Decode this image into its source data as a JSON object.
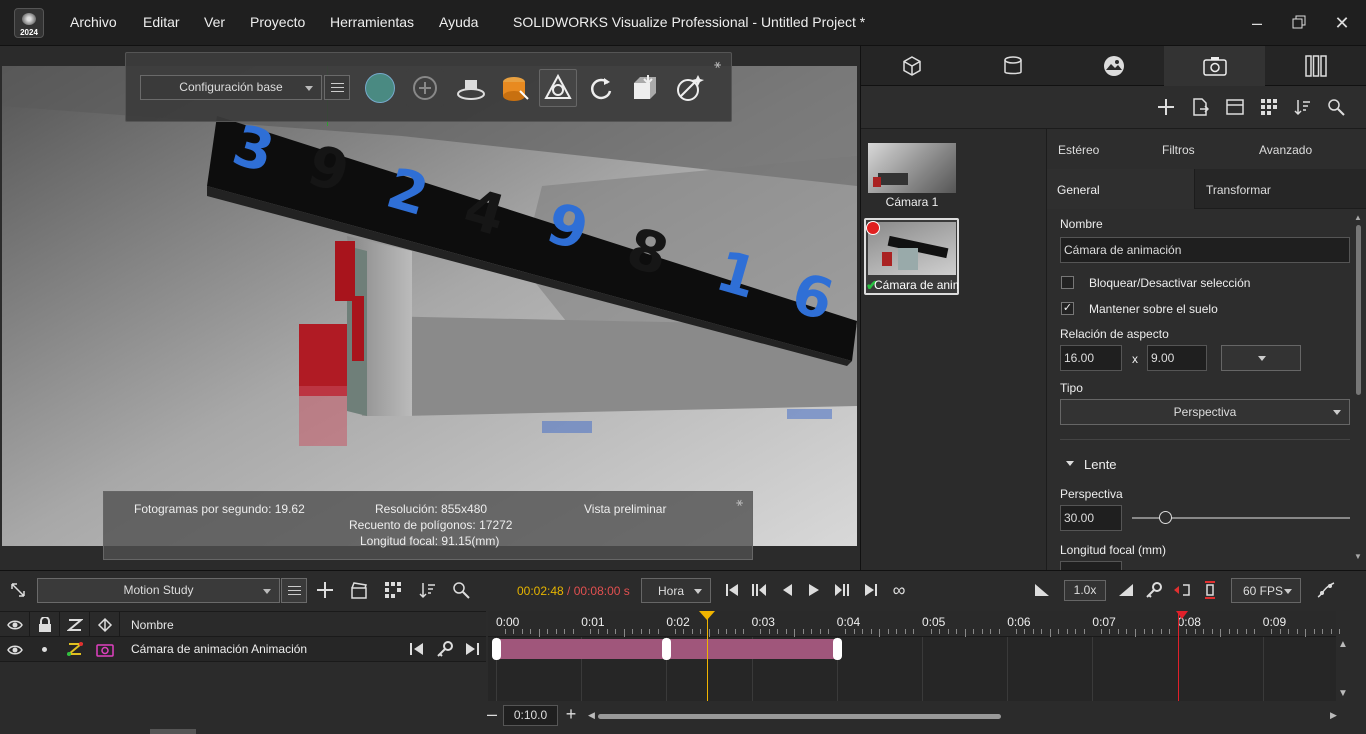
{
  "app": {
    "logo_year": "2024",
    "title": "SOLIDWORKS Visualize Professional - Untitled Project *",
    "menu": [
      "Archivo",
      "Editar",
      "Ver",
      "Proyecto",
      "Herramientas",
      "Ayuda"
    ]
  },
  "viewport_toolbar": {
    "config_label": "Configuración base"
  },
  "viewport_status": {
    "fps": "Fotogramas por segundo: 19.62",
    "resolution": "Resolución: 855x480",
    "polygons": "Recuento de polígonos: 17272",
    "focal": "Longitud focal: 91.15(mm)",
    "mode": "Vista preliminar"
  },
  "scene": {
    "digits": [
      "3",
      "9",
      "2",
      "4",
      "9",
      "8",
      "1",
      "6"
    ]
  },
  "thumbnails": [
    {
      "label": "Cámara 1"
    },
    {
      "label": "Cámara de animación"
    }
  ],
  "props": {
    "tabs_top": [
      "Estéreo",
      "Filtros",
      "Avanzado"
    ],
    "tabs_sub": [
      "General",
      "Transformar"
    ],
    "name_label": "Nombre",
    "name_value": "Cámara de animación",
    "lock_label": "Bloquear/Desactivar selección",
    "lock_checked": false,
    "ground_label": "Mantener sobre el suelo",
    "ground_checked": true,
    "aspect_label": "Relación de aspecto",
    "aspect_w": "16.00",
    "aspect_x": "x",
    "aspect_h": "9.00",
    "type_label": "Tipo",
    "type_value": "Perspectiva",
    "lens_section": "Lente",
    "perspective_label": "Perspectiva",
    "perspective_value": "30.00",
    "perspective_slider_fraction": 0.15,
    "focal_label": "Longitud focal (mm)"
  },
  "bottom": {
    "study_label": "Motion Study",
    "time_current": "00:02:48",
    "time_sep": " / ",
    "time_total": "00:08:00 s",
    "time_unit": "Hora",
    "speed": "1.0x",
    "fps": "60 FPS",
    "zoom_value": "0:10.0",
    "column_name": "Nombre",
    "row_name": "Cámara de animación Animación",
    "ticks": [
      "0:00",
      "0:01",
      "0:02",
      "0:03",
      "0:04",
      "0:05",
      "0:06",
      "0:07",
      "0:08",
      "0:09"
    ],
    "playhead_seconds": 2.48,
    "end_marker_seconds": 8.0,
    "keyframes_seconds": [
      0,
      2,
      4
    ]
  },
  "colors": {
    "keyframe_bar": "#a0567b",
    "playhead": "#f0b400",
    "end_marker": "#e0202a",
    "time_current": "#e6b400",
    "time_total": "#e05050",
    "camera_icon": "#e040c0"
  }
}
